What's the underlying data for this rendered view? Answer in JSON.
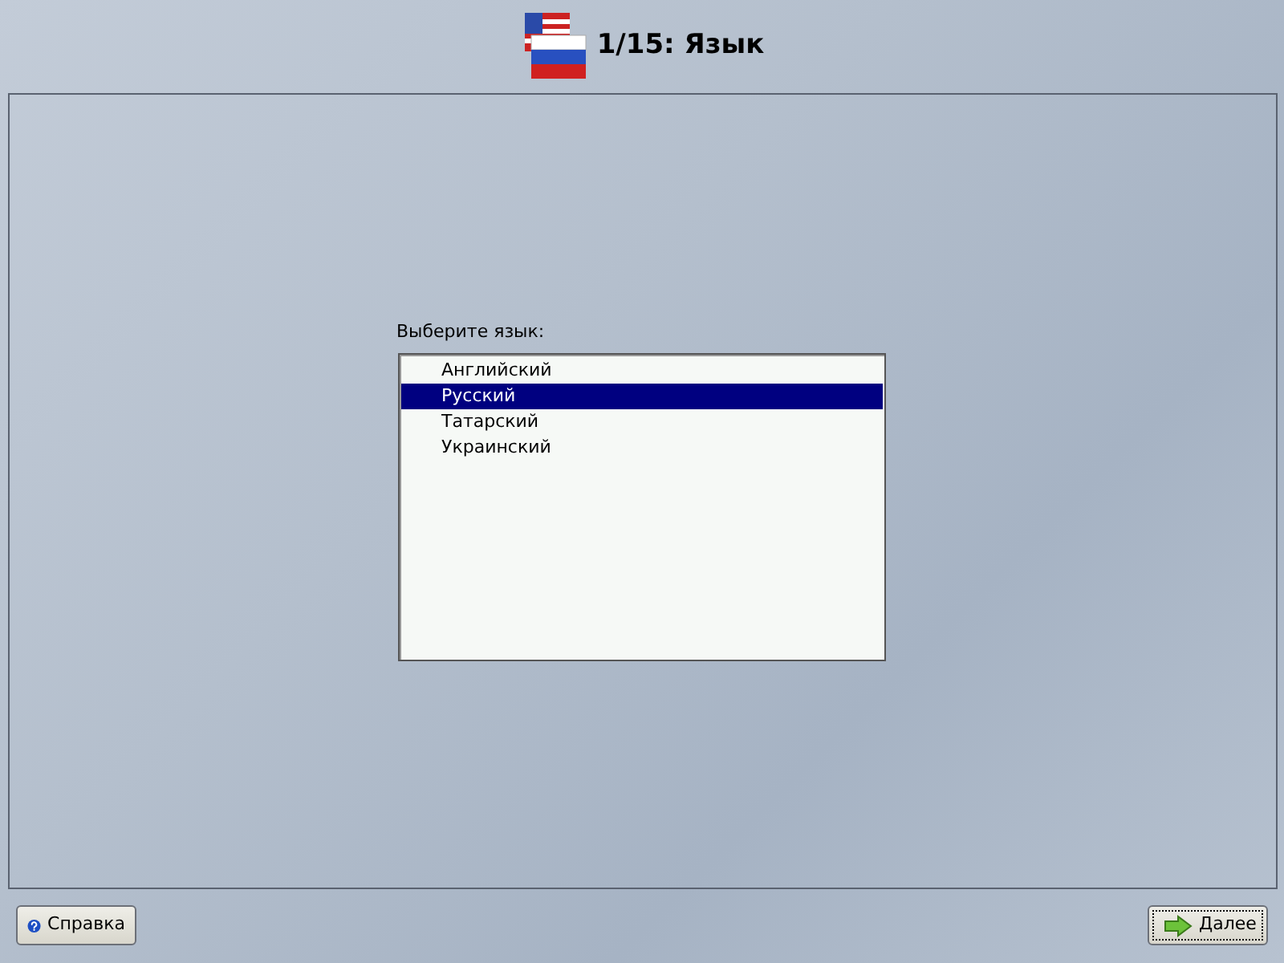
{
  "header": {
    "title": "1/15: Язык"
  },
  "prompt": "Выберите язык:",
  "languages": [
    {
      "label": "Английский",
      "selected": false
    },
    {
      "label": "Русский",
      "selected": true
    },
    {
      "label": "Татарский",
      "selected": false
    },
    {
      "label": "Украинский",
      "selected": false
    }
  ],
  "buttons": {
    "help": "Справка",
    "next": "Далее"
  }
}
